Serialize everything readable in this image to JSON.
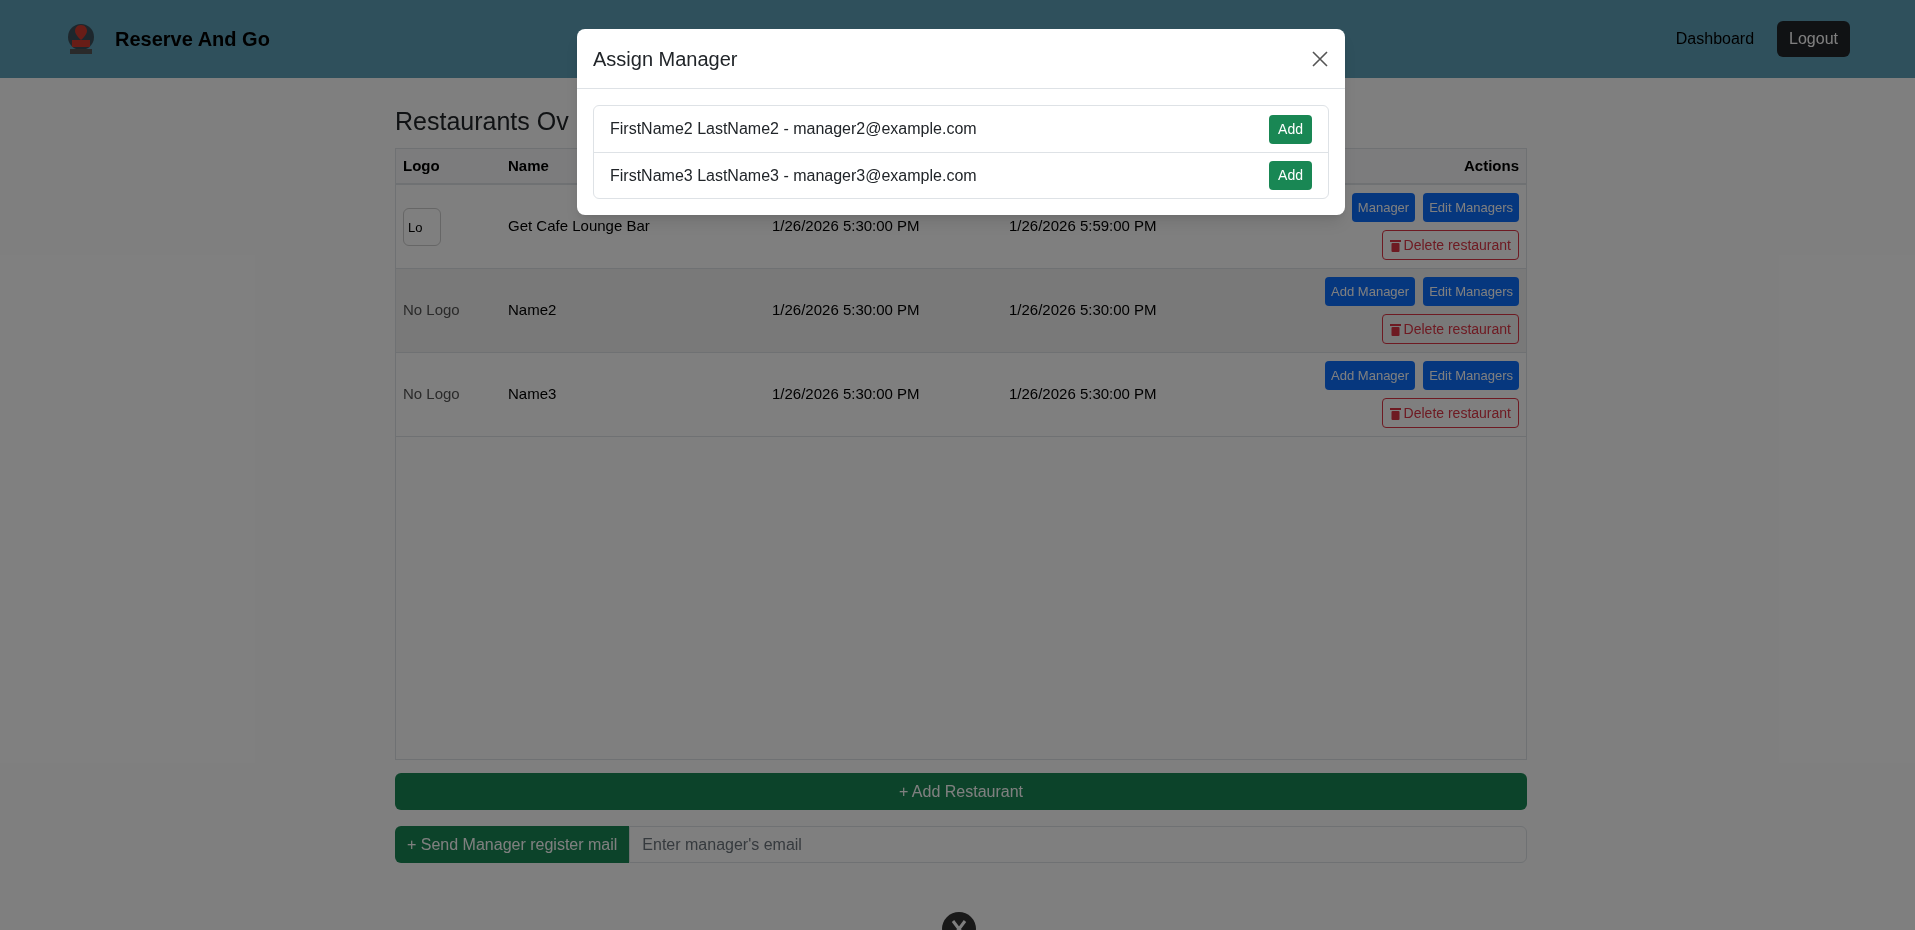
{
  "navbar": {
    "brand": "Reserve And Go",
    "links": [
      "Dashboard"
    ],
    "logout": "Logout"
  },
  "page": {
    "title": "Restaurants Ov"
  },
  "table": {
    "columns": [
      "Logo",
      "Name",
      "Actions"
    ],
    "rows": [
      {
        "logo": {
          "kind": "broken_image",
          "text": "Lo"
        },
        "name": "Get Cafe Lounge Bar",
        "column_3": "1/26/2026 5:30:00 PM",
        "column_4": "1/26/2026 5:59:00 PM",
        "actions": [
          {
            "kind": "primary",
            "label": "Manager"
          },
          {
            "kind": "primary",
            "label": "Edit Managers"
          },
          {
            "kind": "danger",
            "label": "Delete restaurant"
          }
        ]
      },
      {
        "logo": {
          "kind": "text",
          "text": "No Logo"
        },
        "name": "Name2",
        "column_3": "1/26/2026 5:30:00 PM",
        "column_4": "1/26/2026 5:30:00 PM",
        "actions": [
          {
            "kind": "primary",
            "label": "Add Manager"
          },
          {
            "kind": "primary",
            "label": "Edit Managers"
          },
          {
            "kind": "danger",
            "label": "Delete restaurant"
          }
        ]
      },
      {
        "logo": {
          "kind": "text",
          "text": "No Logo"
        },
        "name": "Name3",
        "column_3": "1/26/2026 5:30:00 PM",
        "column_4": "1/26/2026 5:30:00 PM",
        "actions": [
          {
            "kind": "primary",
            "label": "Add Manager"
          },
          {
            "kind": "primary",
            "label": "Edit Managers"
          },
          {
            "kind": "danger",
            "label": "Delete restaurant"
          }
        ]
      }
    ]
  },
  "add_restaurant": "+ Add Restaurant",
  "invite": {
    "button": "+ Send Manager register mail",
    "placeholder": "Enter manager's email"
  },
  "modal": {
    "title": "Assign Manager",
    "items": [
      {
        "text": "FirstName2 LastName2 - manager2@example.com",
        "button": "Add"
      },
      {
        "text": "FirstName3 LastName3 - manager3@example.com",
        "button": "Add"
      }
    ]
  }
}
